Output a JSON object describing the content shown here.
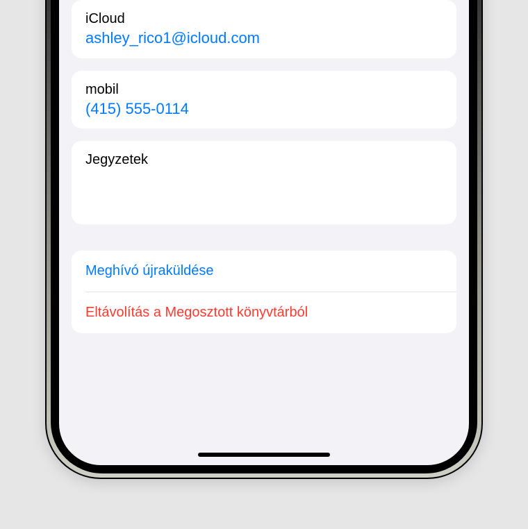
{
  "contact": {
    "icloud": {
      "label": "iCloud",
      "value": "ashley_rico1@icloud.com"
    },
    "mobile": {
      "label": "mobil",
      "value": "(415) 555-0114"
    },
    "notes": {
      "label": "Jegyzetek"
    }
  },
  "actions": {
    "resend": "Meghívó újraküldése",
    "remove": "Eltávolítás a Megosztott könyvtárból"
  },
  "colors": {
    "link": "#007aff",
    "destructive": "#ff3b30",
    "bg": "#f2f2f7"
  }
}
